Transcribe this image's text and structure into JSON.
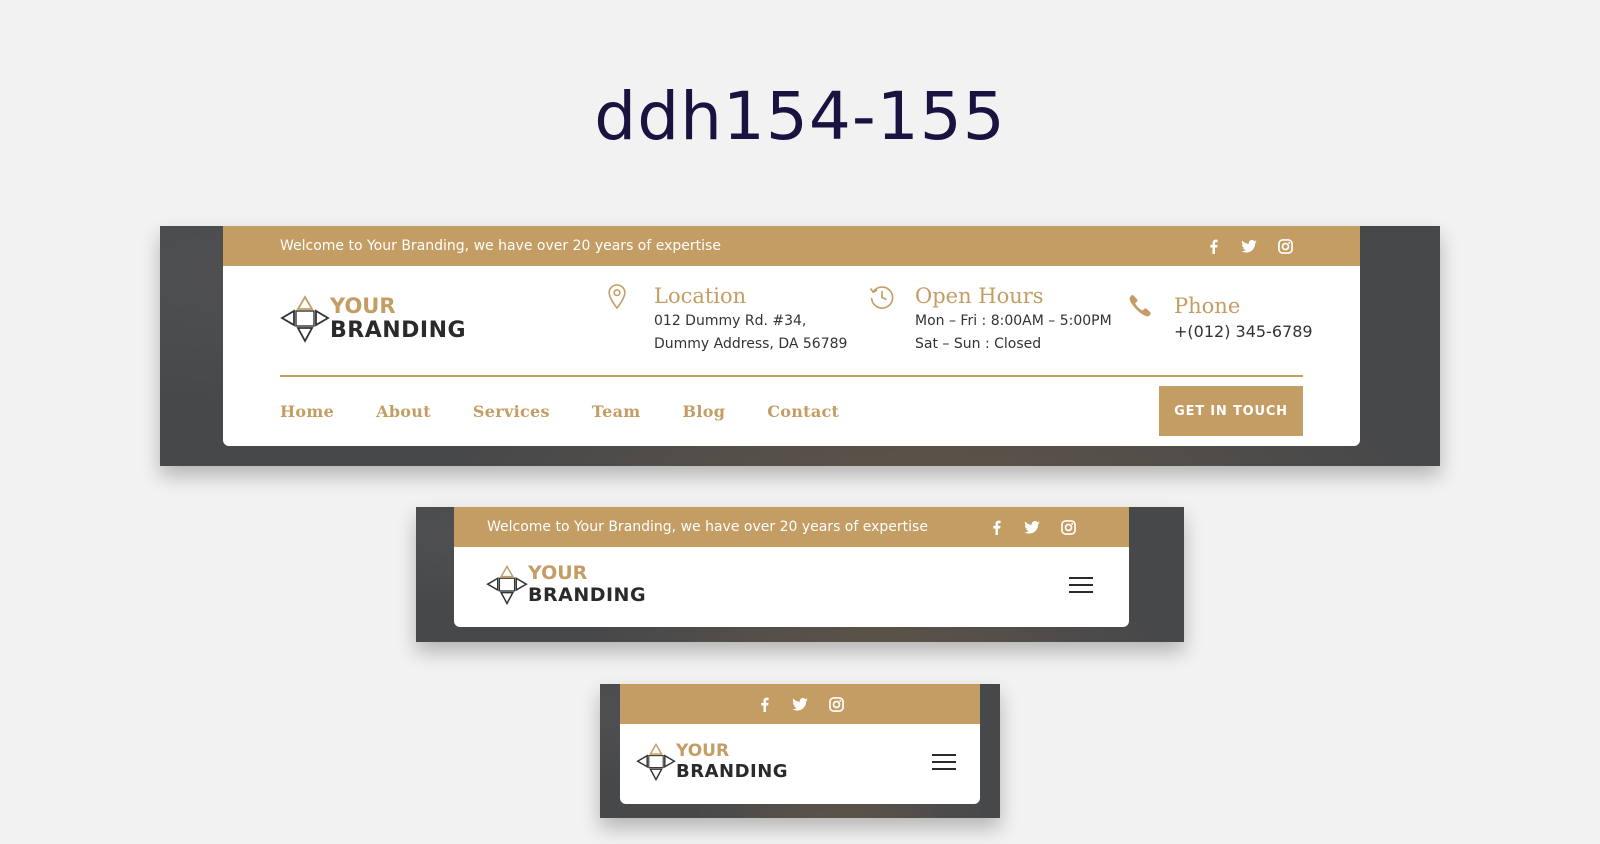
{
  "title": "ddh154-155",
  "colors": {
    "accent": "#c39d63",
    "title": "#1c1240",
    "frame": "#47484a",
    "text": "#333333"
  },
  "topbar": {
    "welcome": "Welcome to Your Branding, we have over 20 years of expertise",
    "social": [
      "facebook-icon",
      "twitter-icon",
      "instagram-icon"
    ]
  },
  "logo": {
    "line1": "YOUR",
    "line2": "BRANDING"
  },
  "info": {
    "location": {
      "title": "Location",
      "line1": "012 Dummy Rd. #34,",
      "line2": "Dummy Address, DA 56789",
      "icon": "map-pin-icon"
    },
    "hours": {
      "title": "Open Hours",
      "line1": "Mon – Fri : 8:00AM – 5:00PM",
      "line2": "Sat – Sun : Closed",
      "icon": "clock-history-icon"
    },
    "phone": {
      "title": "Phone",
      "line1": "+(012) 345-6789",
      "icon": "phone-icon"
    }
  },
  "nav": {
    "items": [
      "Home",
      "About",
      "Services",
      "Team",
      "Blog",
      "Contact"
    ]
  },
  "cta": {
    "label": "GET IN TOUCH"
  },
  "menu_icon": "hamburger-menu-icon"
}
